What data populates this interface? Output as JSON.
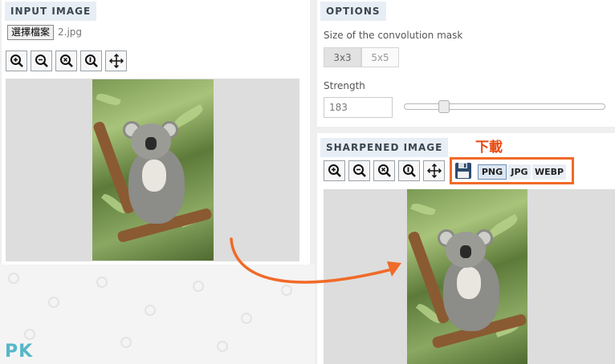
{
  "input_section": {
    "title": "INPUT IMAGE",
    "file_button": "選擇檔案",
    "file_name": "2.jpg",
    "tools": [
      "zoom-in-icon",
      "zoom-out-icon",
      "zoom-reset-icon",
      "zoom-actual-icon",
      "move-icon"
    ]
  },
  "options_section": {
    "title": "OPTIONS",
    "mask_label": "Size of the convolution mask",
    "mask_options": [
      "3x3",
      "5x5"
    ],
    "mask_selected": "3x3",
    "strength_label": "Strength",
    "strength_value": "183",
    "strength_slider_fraction": 0.18
  },
  "sharpened_section": {
    "title": "SHARPENED IMAGE",
    "tools": [
      "zoom-in-icon",
      "zoom-out-icon",
      "zoom-reset-icon",
      "zoom-actual-icon",
      "move-icon"
    ],
    "save_icon": "floppy-disk-icon",
    "formats": [
      "PNG",
      "JPG",
      "WEBP"
    ],
    "format_selected": "PNG"
  },
  "annotation": {
    "download_label": "下載",
    "arrow_color": "#f06a28",
    "highlight_color": "#f06a28"
  },
  "watermark": "PK"
}
